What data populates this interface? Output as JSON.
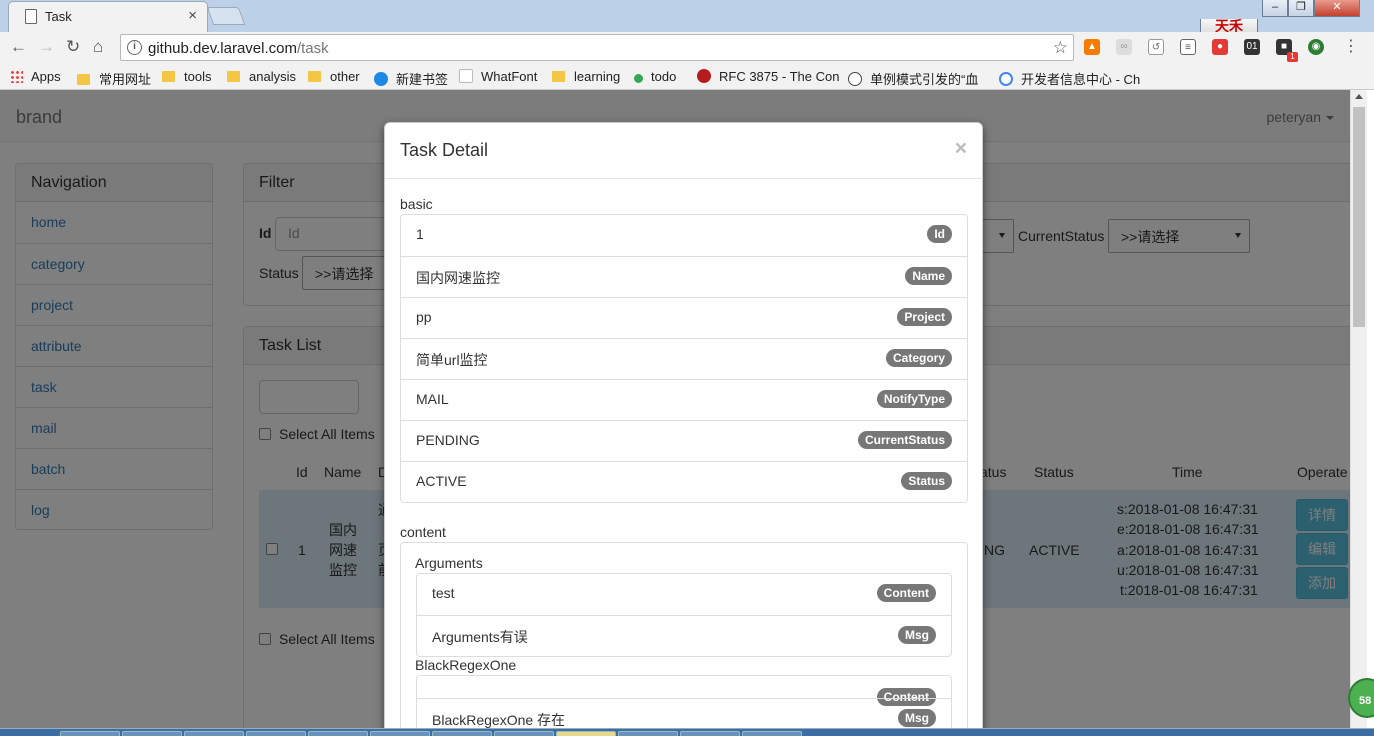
{
  "browser": {
    "tab_title": "Task",
    "tab_close": "×",
    "user_button": "天禾",
    "minimize": "–",
    "maximize": "❐",
    "close": "✕",
    "url_host": "github.dev.laravel.com",
    "url_path": "/task",
    "ext_badge": "1",
    "ext_01": "01",
    "bookmarks": [
      "Apps",
      "常用网址",
      "tools",
      "analysis",
      "other",
      "新建书签",
      "WhatFont",
      "learning",
      "todo",
      "RFC 3875 - The Con",
      "单例模式引发的“血",
      "开发者信息中心 - Ch"
    ]
  },
  "navbar": {
    "brand": "brand",
    "user": "peteryan"
  },
  "sidebar": {
    "title": "Navigation",
    "items": [
      "home",
      "category",
      "project",
      "attribute",
      "task",
      "mail",
      "batch",
      "log"
    ]
  },
  "filter": {
    "title": "Filter",
    "id_label": "Id",
    "id_placeholder": "Id",
    "current_status_label": "CurrentStatus",
    "current_status_value": ">>请选择",
    "status_label": "Status",
    "status_value": ">>请选择"
  },
  "task_list": {
    "title": "Task List",
    "select_all": "Select All Items",
    "headers": {
      "id": "Id",
      "name": "Name",
      "d": "D",
      "current_status": "atus",
      "status": "Status",
      "time": "Time",
      "operate": "Operate"
    },
    "row": {
      "id": "1",
      "name": [
        "国内",
        "网速",
        "监控"
      ],
      "desc": [
        "通",
        "页",
        "前"
      ],
      "current_status": "NG",
      "status": "ACTIVE",
      "times": [
        "s:2018-01-08 16:47:31",
        "e:2018-01-08 16:47:31",
        "a:2018-01-08 16:47:31",
        "u:2018-01-08 16:47:31",
        "t:2018-01-08 16:47:31"
      ],
      "buttons": [
        "详情",
        "编辑",
        "添加"
      ]
    }
  },
  "modal": {
    "title": "Task Detail",
    "close": "×",
    "basic_label": "basic",
    "basic": [
      {
        "value": "1",
        "badge": "Id"
      },
      {
        "value": "国内网速监控",
        "badge": "Name"
      },
      {
        "value": "pp",
        "badge": "Project"
      },
      {
        "value": "简单url监控",
        "badge": "Category"
      },
      {
        "value": "MAIL",
        "badge": "NotifyType"
      },
      {
        "value": "PENDING",
        "badge": "CurrentStatus"
      },
      {
        "value": "ACTIVE",
        "badge": "Status"
      }
    ],
    "content_label": "content",
    "groups": [
      {
        "name": "Arguments",
        "items": [
          {
            "value": "test",
            "badge": "Content"
          },
          {
            "value": "Arguments有误",
            "badge": "Msg"
          }
        ]
      },
      {
        "name": "BlackRegexOne",
        "items": [
          {
            "value": "",
            "badge": "Content"
          },
          {
            "value": "BlackRegexOne 存在",
            "badge": "Msg"
          }
        ]
      }
    ]
  },
  "floating_badge": "58"
}
